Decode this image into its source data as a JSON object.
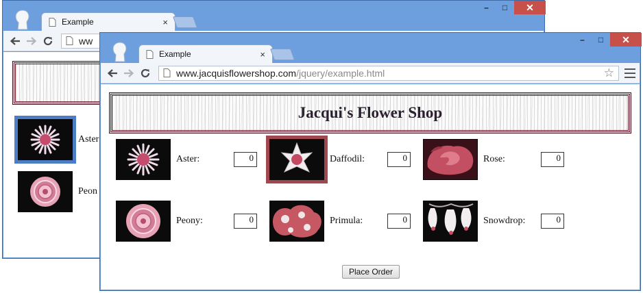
{
  "colors": {
    "window_frame": "#6d9fde",
    "close_button": "#c7504b",
    "selected_frame_front": "#a1474f",
    "selected_frame_back": "#4d7dc4",
    "banner_border": "#6b1b2c"
  },
  "back_window": {
    "tab": {
      "title": "Example",
      "close": "×"
    },
    "controls": {
      "minimize": "–",
      "maximize": "□",
      "close": "✕"
    },
    "omnibox_text": "ww",
    "flowers": [
      {
        "label": "Aster",
        "icon": "aster-flower-icon",
        "selected": true
      },
      {
        "label": "Peon",
        "icon": "peony-flower-icon",
        "selected": false
      }
    ]
  },
  "front_window": {
    "tab": {
      "title": "Example",
      "close": "×"
    },
    "controls": {
      "minimize": "–",
      "maximize": "□",
      "close": "✕"
    },
    "toolbar": {
      "back_icon": "back-arrow-icon",
      "forward_icon": "forward-arrow-icon",
      "reload_icon": "reload-icon",
      "url_host": "www.jacquisflowershop.com",
      "url_path": "/jquery/example.html",
      "bookmark_icon": "star-icon",
      "menu_icon": "menu-icon"
    },
    "page": {
      "title": "Jacqui's Flower Shop",
      "flowers": [
        [
          {
            "label": "Aster:",
            "value": "0",
            "icon": "aster-flower-icon",
            "selected": false
          },
          {
            "label": "Daffodil:",
            "value": "0",
            "icon": "daffodil-flower-icon",
            "selected": true
          },
          {
            "label": "Rose:",
            "value": "0",
            "icon": "rose-flower-icon",
            "selected": false
          }
        ],
        [
          {
            "label": "Peony:",
            "value": "0",
            "icon": "peony-flower-icon",
            "selected": false
          },
          {
            "label": "Primula:",
            "value": "0",
            "icon": "primula-flower-icon",
            "selected": false
          },
          {
            "label": "Snowdrop:",
            "value": "0",
            "icon": "snowdrop-flower-icon",
            "selected": false
          }
        ]
      ],
      "submit_label": "Place Order"
    }
  }
}
